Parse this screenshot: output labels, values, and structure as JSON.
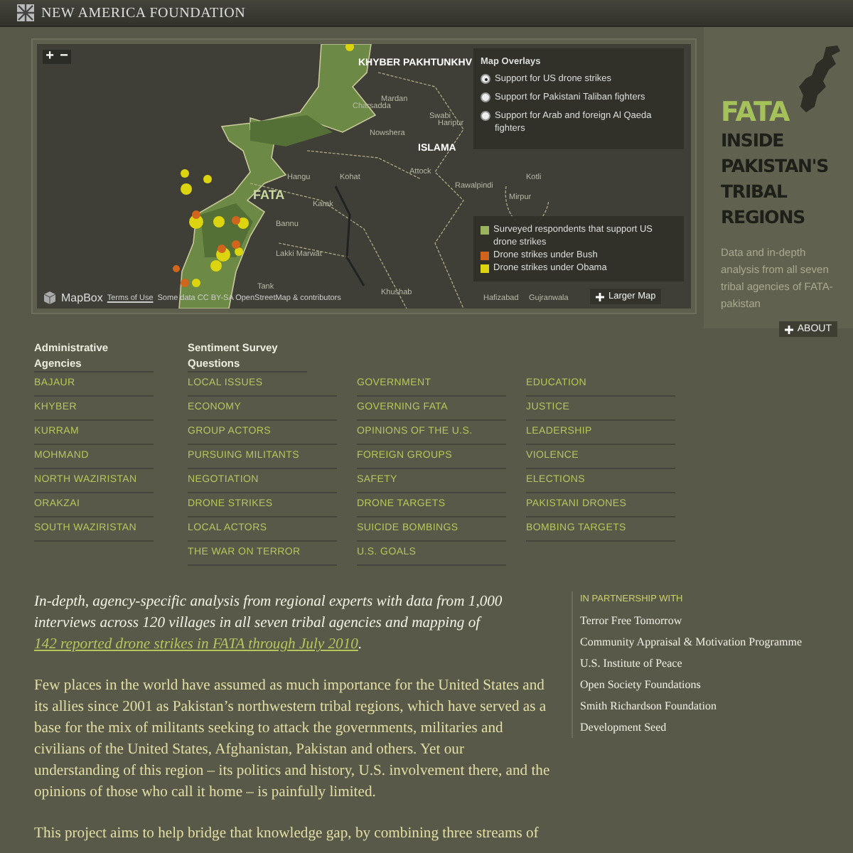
{
  "header": {
    "title": "NEW AMERICA FOUNDATION"
  },
  "map": {
    "zoom_in": "+",
    "zoom_out": "−",
    "labels": [
      "KHYBER PAKHTUNKHV",
      "Mardan",
      "Charsadda",
      "Swabi",
      "Nowshera",
      "Attock",
      "Hangu",
      "Kohat",
      "Karak",
      "Bannu",
      "Lakki Marwat",
      "Tank",
      "Khushab",
      "FATA",
      "Haripur",
      "ISLAMA",
      "Rawalpindi",
      "Kotli",
      "Mirpur",
      "Gujranwala",
      "Hafizabad"
    ],
    "overlays": {
      "title": "Map Overlays",
      "options": [
        {
          "label": "Support for US drone strikes",
          "selected": true
        },
        {
          "label": "Support for Pakistani Taliban fighters",
          "selected": false
        },
        {
          "label": "Support for Arab and foreign Al Qaeda fighters",
          "selected": false
        }
      ]
    },
    "legend": [
      {
        "label": "Surveyed respondents that support US drone strikes",
        "color": "#9bb55f"
      },
      {
        "label": "Drone strikes under Bush",
        "color": "#d0661e"
      },
      {
        "label": "Drone strikes under Obama",
        "color": "#dcd40e"
      }
    ],
    "larger_map": "Larger Map",
    "attribution": {
      "brand": "MapBox",
      "terms": "Terms of Use",
      "credit": "Some data CC BY-SA OpenStreetMap & contributors"
    }
  },
  "side": {
    "title": "FATA",
    "subtitle": "INSIDE PAKISTAN'S TRIBAL REGIONS",
    "description": "Data and in-depth analysis from all seven tribal agencies of FATA-pakistan",
    "about": "ABOUT"
  },
  "nav": {
    "agencies": {
      "heading": "Administrative Agencies",
      "items": [
        "BAJAUR",
        "KHYBER",
        "KURRAM",
        "MOHMAND",
        "NORTH WAZIRISTAN",
        "ORAKZAI",
        "SOUTH WAZIRISTAN"
      ]
    },
    "survey": {
      "heading": "Sentiment Survey Questions",
      "items": [
        "LOCAL ISSUES",
        "ECONOMY",
        "GROUP ACTORS",
        "PURSUING MILITANTS",
        "NEGOTIATION",
        "DRONE STRIKES",
        "LOCAL ACTORS",
        "THE WAR ON TERROR",
        "GOVERNMENT",
        "GOVERNING FATA",
        "OPINIONS OF THE U.S.",
        "FOREIGN GROUPS",
        "SAFETY",
        "DRONE TARGETS",
        "SUICIDE BOMBINGS",
        "U.S. GOALS",
        "EDUCATION",
        "JUSTICE",
        "LEADERSHIP",
        "VIOLENCE",
        "ELECTIONS",
        "PAKISTANI DRONES",
        "BOMBING TARGETS"
      ]
    }
  },
  "body": {
    "intro": {
      "text": "In-depth, agency-specific analysis from regional experts with data from 1,000 interviews across 120 villages in all seven tribal agencies and mapping of",
      "link": "142 reported drone strikes in FATA through July 2010",
      "end": "."
    },
    "paragraphs": [
      "Few places in the world have assumed as much importance for the United States and its allies since 2001 as Pakistan’s northwestern tribal regions, which have served as a base for the mix of militants seeking to attack the governments, militaries and civilians of the United States, Afghanistan, Pakistan and others. Yet our understanding of this region – its politics and history, U.S. involvement there, and the opinions of those who call it home – is painfully limited.",
      "This project aims to help bridge that knowledge gap, by combining three streams of"
    ]
  },
  "partners": {
    "heading": "IN PARTNERSHIP WITH",
    "items": [
      "Terror Free Tomorrow",
      "Community Appraisal & Motivation Programme",
      "U.S. Institute of Peace",
      "Open Society Foundations",
      "Smith Richardson Foundation",
      "Development Seed"
    ]
  }
}
